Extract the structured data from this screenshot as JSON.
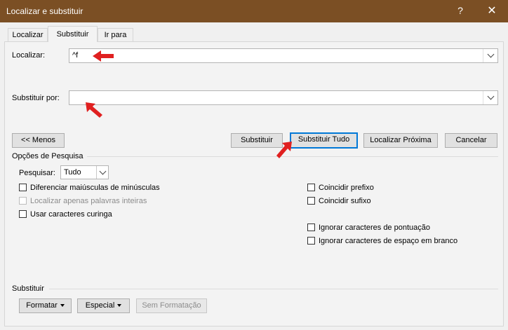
{
  "window": {
    "title": "Localizar e substituir",
    "help_label": "?",
    "close_label": "✕"
  },
  "tabs": [
    {
      "label": "Localizar"
    },
    {
      "label": "Substituir"
    },
    {
      "label": "Ir para"
    }
  ],
  "find": {
    "label": "Localizar:",
    "value": "^f"
  },
  "replace": {
    "label": "Substituir por:",
    "value": ""
  },
  "buttons": {
    "less": "<< Menos",
    "replace": "Substituir",
    "replace_all": "Substituir Tudo",
    "find_next": "Localizar Próxima",
    "cancel": "Cancelar"
  },
  "search_options": {
    "title": "Opções de Pesquisa",
    "search_label": "Pesquisar:",
    "search_value": "Tudo",
    "left": [
      {
        "label": "Diferenciar maiúsculas de minúsculas",
        "checked": false,
        "disabled": false
      },
      {
        "label": "Localizar apenas palavras inteiras",
        "checked": false,
        "disabled": true
      },
      {
        "label": "Usar caracteres curinga",
        "checked": false,
        "disabled": false
      }
    ],
    "right": [
      {
        "label": "Coincidir prefixo",
        "checked": false,
        "disabled": false
      },
      {
        "label": "Coincidir sufixo",
        "checked": false,
        "disabled": false
      },
      {
        "label": "Ignorar caracteres de pontuação",
        "checked": false,
        "disabled": false
      },
      {
        "label": "Ignorar caracteres de espaço em branco",
        "checked": false,
        "disabled": false
      }
    ]
  },
  "replace_section": {
    "title": "Substituir",
    "format": "Formatar",
    "special": "Especial",
    "no_format": "Sem Formatação"
  },
  "colors": {
    "titlebar": "#7b4f24",
    "annotation_arrow": "#e02020",
    "focus": "#0078d7"
  }
}
